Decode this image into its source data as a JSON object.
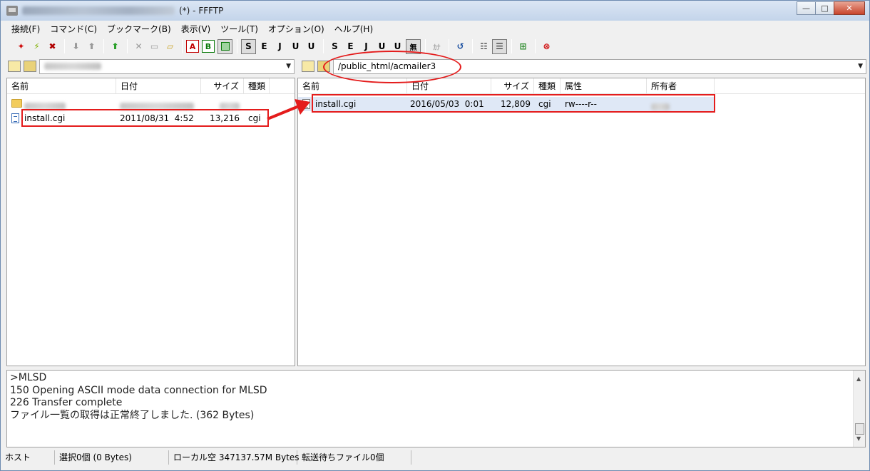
{
  "window": {
    "title": "(*) - FFFTP",
    "minimize": "—",
    "maximize": "□",
    "close": "✕"
  },
  "menu": [
    "接続(F)",
    "コマンド(C)",
    "ブックマーク(B)",
    "表示(V)",
    "ツール(T)",
    "オプション(O)",
    "ヘルプ(H)"
  ],
  "toolbar": {
    "icons": [
      "connect-icon",
      "quick-connect-icon",
      "disconnect-icon",
      "download-icon",
      "upload-icon",
      "mirror-upload-icon",
      "delete-icon",
      "rename-icon",
      "mkdir-icon",
      "mode-ascii-icon",
      "mode-binary-icon",
      "mode-auto-icon",
      "kanji-sjis-icon",
      "kanji-euc-icon",
      "kanji-jis-icon",
      "kanji-utf8n-icon",
      "kanji-utf8bom-icon",
      "kanji-sjis-host-icon",
      "kanji-euc-host-icon",
      "kanji-jis-host-icon",
      "kanji-utf8n-host-icon",
      "kanji-utf8bom-host-icon",
      "kanji-none-icon",
      "kana-convert-icon",
      "refresh-icon",
      "list-view-icon",
      "detail-view-icon",
      "sync-dir-icon",
      "stop-icon"
    ],
    "labels": {
      "a": "A",
      "b": "B",
      "s": "S",
      "e": "E",
      "j": "J",
      "u": "U",
      "none": "無",
      "kana": "ｶﾅ"
    }
  },
  "local": {
    "path_blurred": true,
    "columns": [
      "名前",
      "日付",
      "サイズ",
      "種類"
    ],
    "rows": [
      {
        "name": "",
        "date": "",
        "size": "",
        "type": "",
        "is_folder": true,
        "blurred": true
      },
      {
        "name": "install.cgi",
        "date": "2011/08/31  4:52",
        "size": "13,216",
        "type": "cgi",
        "is_folder": false
      }
    ]
  },
  "remote": {
    "path": "/public_html/acmailer3",
    "columns": [
      "名前",
      "日付",
      "サイズ",
      "種類",
      "属性",
      "所有者"
    ],
    "rows": [
      {
        "name": "install.cgi",
        "date": "2016/05/03  0:01",
        "size": "12,809",
        "type": "cgi",
        "attr": "rw----r--",
        "owner": ""
      }
    ]
  },
  "log": {
    "lines": [
      ">MLSD",
      "150 Opening ASCII mode data connection for MLSD",
      "226 Transfer complete",
      "ファイル一覧の取得は正常終了しました. (362 Bytes)"
    ]
  },
  "status": {
    "host": "ホスト",
    "selection": "選択0個 (0 Bytes)",
    "local_free": "ローカル空 347137.57M Bytes",
    "queue": "転送待ちファイル0個"
  },
  "annotation_color": "#e41c1c"
}
